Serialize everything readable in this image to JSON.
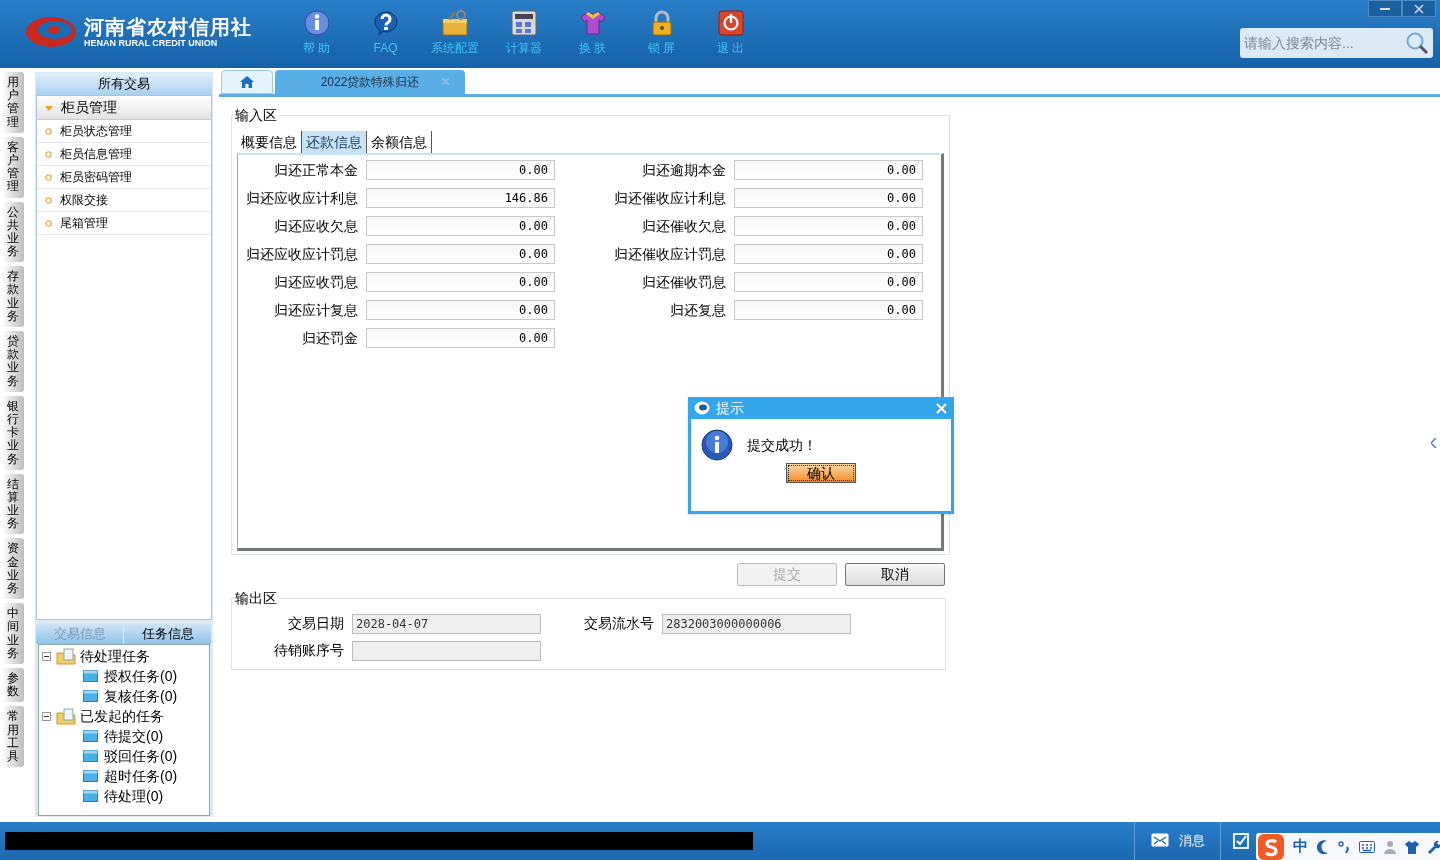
{
  "header": {
    "logo_cn": "河南省农村信用社",
    "logo_en": "HENAN RURAL CREDIT UNION",
    "toolbar": [
      {
        "kind": "info",
        "label": "帮 助"
      },
      {
        "kind": "faq",
        "label": "FAQ"
      },
      {
        "kind": "config",
        "label": "系统配置"
      },
      {
        "kind": "calc",
        "label": "计算器"
      },
      {
        "kind": "skin",
        "label": "换 肤"
      },
      {
        "kind": "lock",
        "label": "锁 屏"
      },
      {
        "kind": "exit",
        "label": "退 出"
      }
    ],
    "search": {
      "placeholder": "请输入搜索内容..."
    }
  },
  "side_tabs": [
    "用户管理",
    "客户管理",
    "公共业务",
    "存款业务",
    "贷款业务",
    "银行卡业务",
    "结算业务",
    "资金业务",
    "中间业务",
    "参数",
    "常用工具"
  ],
  "sidebar": {
    "title": "所有交易",
    "group": {
      "label": "柜员管理",
      "expanded": true,
      "items": [
        "柜员状态管理",
        "柜员信息管理",
        "柜员密码管理",
        "权限交接",
        "尾箱管理"
      ]
    },
    "bottom_tabs": [
      {
        "label": "交易信息",
        "selected": false
      },
      {
        "label": "任务信息",
        "selected": true
      }
    ],
    "tree": [
      {
        "label": "待处理任务",
        "expanded": true,
        "children": [
          {
            "label": "授权任务(0)"
          },
          {
            "label": "复核任务(0)"
          }
        ]
      },
      {
        "label": "已发起的任务",
        "expanded": true,
        "children": [
          {
            "label": "待提交(0)"
          },
          {
            "label": "驳回任务(0)"
          },
          {
            "label": "超时任务(0)"
          },
          {
            "label": "待处理(0)"
          }
        ]
      }
    ]
  },
  "tabs": [
    {
      "kind": "home",
      "selected": false
    },
    {
      "kind": "page",
      "label": "2022贷款特殊归还",
      "selected": true
    }
  ],
  "input_area": {
    "legend": "输入区",
    "tabs": [
      {
        "label": "概要信息",
        "selected": false
      },
      {
        "label": "还款信息",
        "selected": true
      },
      {
        "label": "余额信息",
        "selected": false
      }
    ],
    "left_fields": [
      {
        "label": "归还正常本金",
        "value": "0.00"
      },
      {
        "label": "归还应收应计利息",
        "value": "146.86"
      },
      {
        "label": "归还应收欠息",
        "value": "0.00"
      },
      {
        "label": "归还应收应计罚息",
        "value": "0.00"
      },
      {
        "label": "归还应收罚息",
        "value": "0.00"
      },
      {
        "label": "归还应计复息",
        "value": "0.00"
      },
      {
        "label": "归还罚金",
        "value": "0.00"
      }
    ],
    "right_fields": [
      {
        "label": "归还逾期本金",
        "value": "0.00"
      },
      {
        "label": "归还催收应计利息",
        "value": "0.00"
      },
      {
        "label": "归还催收欠息",
        "value": "0.00"
      },
      {
        "label": "归还催收应计罚息",
        "value": "0.00"
      },
      {
        "label": "归还催收罚息",
        "value": "0.00"
      },
      {
        "label": "归还复息",
        "value": "0.00"
      }
    ]
  },
  "buttons": [
    {
      "label": "提交",
      "disabled": true
    },
    {
      "label": "取消",
      "disabled": false
    }
  ],
  "output_area": {
    "legend": "输出区",
    "fields": [
      {
        "label": "交易日期",
        "value": "2028-04-07"
      },
      {
        "label": "交易流水号",
        "value": "2832003000000006"
      },
      {
        "label": "待销账序号"
      }
    ]
  },
  "dialog": {
    "title": "提示",
    "message": "提交成功！",
    "button": "确认"
  },
  "status_bar": {
    "items": [
      {
        "kind": "message",
        "label": "消息"
      },
      {
        "kind": "todo"
      }
    ]
  },
  "ime": {
    "mode": "中"
  }
}
